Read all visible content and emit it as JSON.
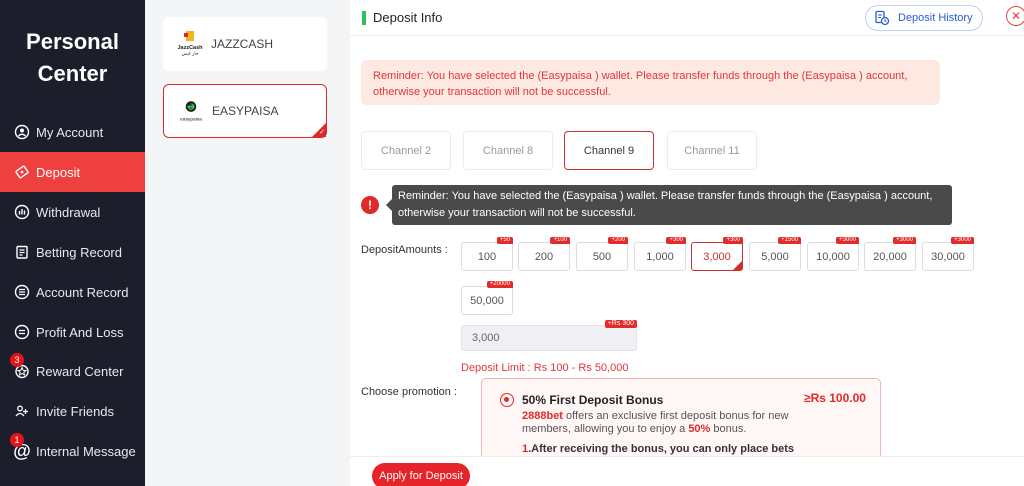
{
  "sidebar": {
    "title_line1": "Personal",
    "title_line2": "Center",
    "items": [
      {
        "label": "My Account",
        "icon": "user-icon"
      },
      {
        "label": "Deposit",
        "icon": "deposit-icon",
        "active": true
      },
      {
        "label": "Withdrawal",
        "icon": "withdrawal-icon"
      },
      {
        "label": "Betting Record",
        "icon": "record-icon"
      },
      {
        "label": "Account Record",
        "icon": "list-icon"
      },
      {
        "label": "Profit And Loss",
        "icon": "profit-icon"
      },
      {
        "label": "Reward Center",
        "icon": "gift-icon",
        "badge": "3"
      },
      {
        "label": "Invite Friends",
        "icon": "invite-icon"
      },
      {
        "label": "Internal Message",
        "icon": "message-icon",
        "badge": "1"
      }
    ]
  },
  "wallets": [
    {
      "label": "JAZZCASH",
      "logo_text": "JazzCash",
      "logo_subtext": "جاز کیش"
    },
    {
      "label": "EASYPAISA",
      "logo_text": "easypaisa",
      "selected": true
    }
  ],
  "header": {
    "title": "Deposit Info",
    "history_label": "Deposit History",
    "close_symbol": "✕"
  },
  "reminder": {
    "text": "Reminder: You have selected the (Easypaisa ) wallet. Please transfer funds through the (Easypaisa ) account, otherwise your transaction will not be successful."
  },
  "channels": [
    {
      "label": "Channel 2"
    },
    {
      "label": "Channel 8"
    },
    {
      "label": "Channel 9",
      "selected": true
    },
    {
      "label": "Channel 11"
    }
  ],
  "tooltip": {
    "line1": "Reminder: You have selected the (Easypaisa ) wallet. Please transfer funds through the (Easypaisa ) account,",
    "line2": "otherwise your transaction will not be successful."
  },
  "deposit_amounts": {
    "label": "DepositAmounts :",
    "options": [
      {
        "value": "100",
        "bonus": "+50"
      },
      {
        "value": "200",
        "bonus": "+100"
      },
      {
        "value": "500",
        "bonus": "+200"
      },
      {
        "value": "1,000",
        "bonus": "+300"
      },
      {
        "value": "3,000",
        "bonus": "+300",
        "selected": true
      },
      {
        "value": "5,000",
        "bonus": "+1500"
      },
      {
        "value": "10,000",
        "bonus": "+3000"
      },
      {
        "value": "20,000",
        "bonus": "+3000"
      },
      {
        "value": "30,000",
        "bonus": "+3000"
      },
      {
        "value": "50,000",
        "bonus": "+20000"
      }
    ],
    "input_value": "3,000",
    "input_bonus": "+Rs  300",
    "limit_text": "Deposit Limit :  Rs  100  -  Rs  50,000"
  },
  "promotion": {
    "label": "Choose promotion :",
    "title": "50% First Deposit Bonus",
    "amount": "≥Rs  100.00",
    "brand": "2888bet",
    "desc_part1": " offers an exclusive first deposit bonus for new members, allowing you to enjoy a ",
    "percent": "50%",
    "desc_part2": " bonus.",
    "note_num": "1",
    "note_text": ".After receiving the bonus, you can only place bets"
  },
  "footer": {
    "apply_label": "Apply for Deposit"
  },
  "colors": {
    "sidebar_bg": "#1c1e2b",
    "accent_red": "#e7232a",
    "active_nav": "#ef4040",
    "header_accent": "#2ec05b",
    "link_blue": "#2a5ed8"
  }
}
